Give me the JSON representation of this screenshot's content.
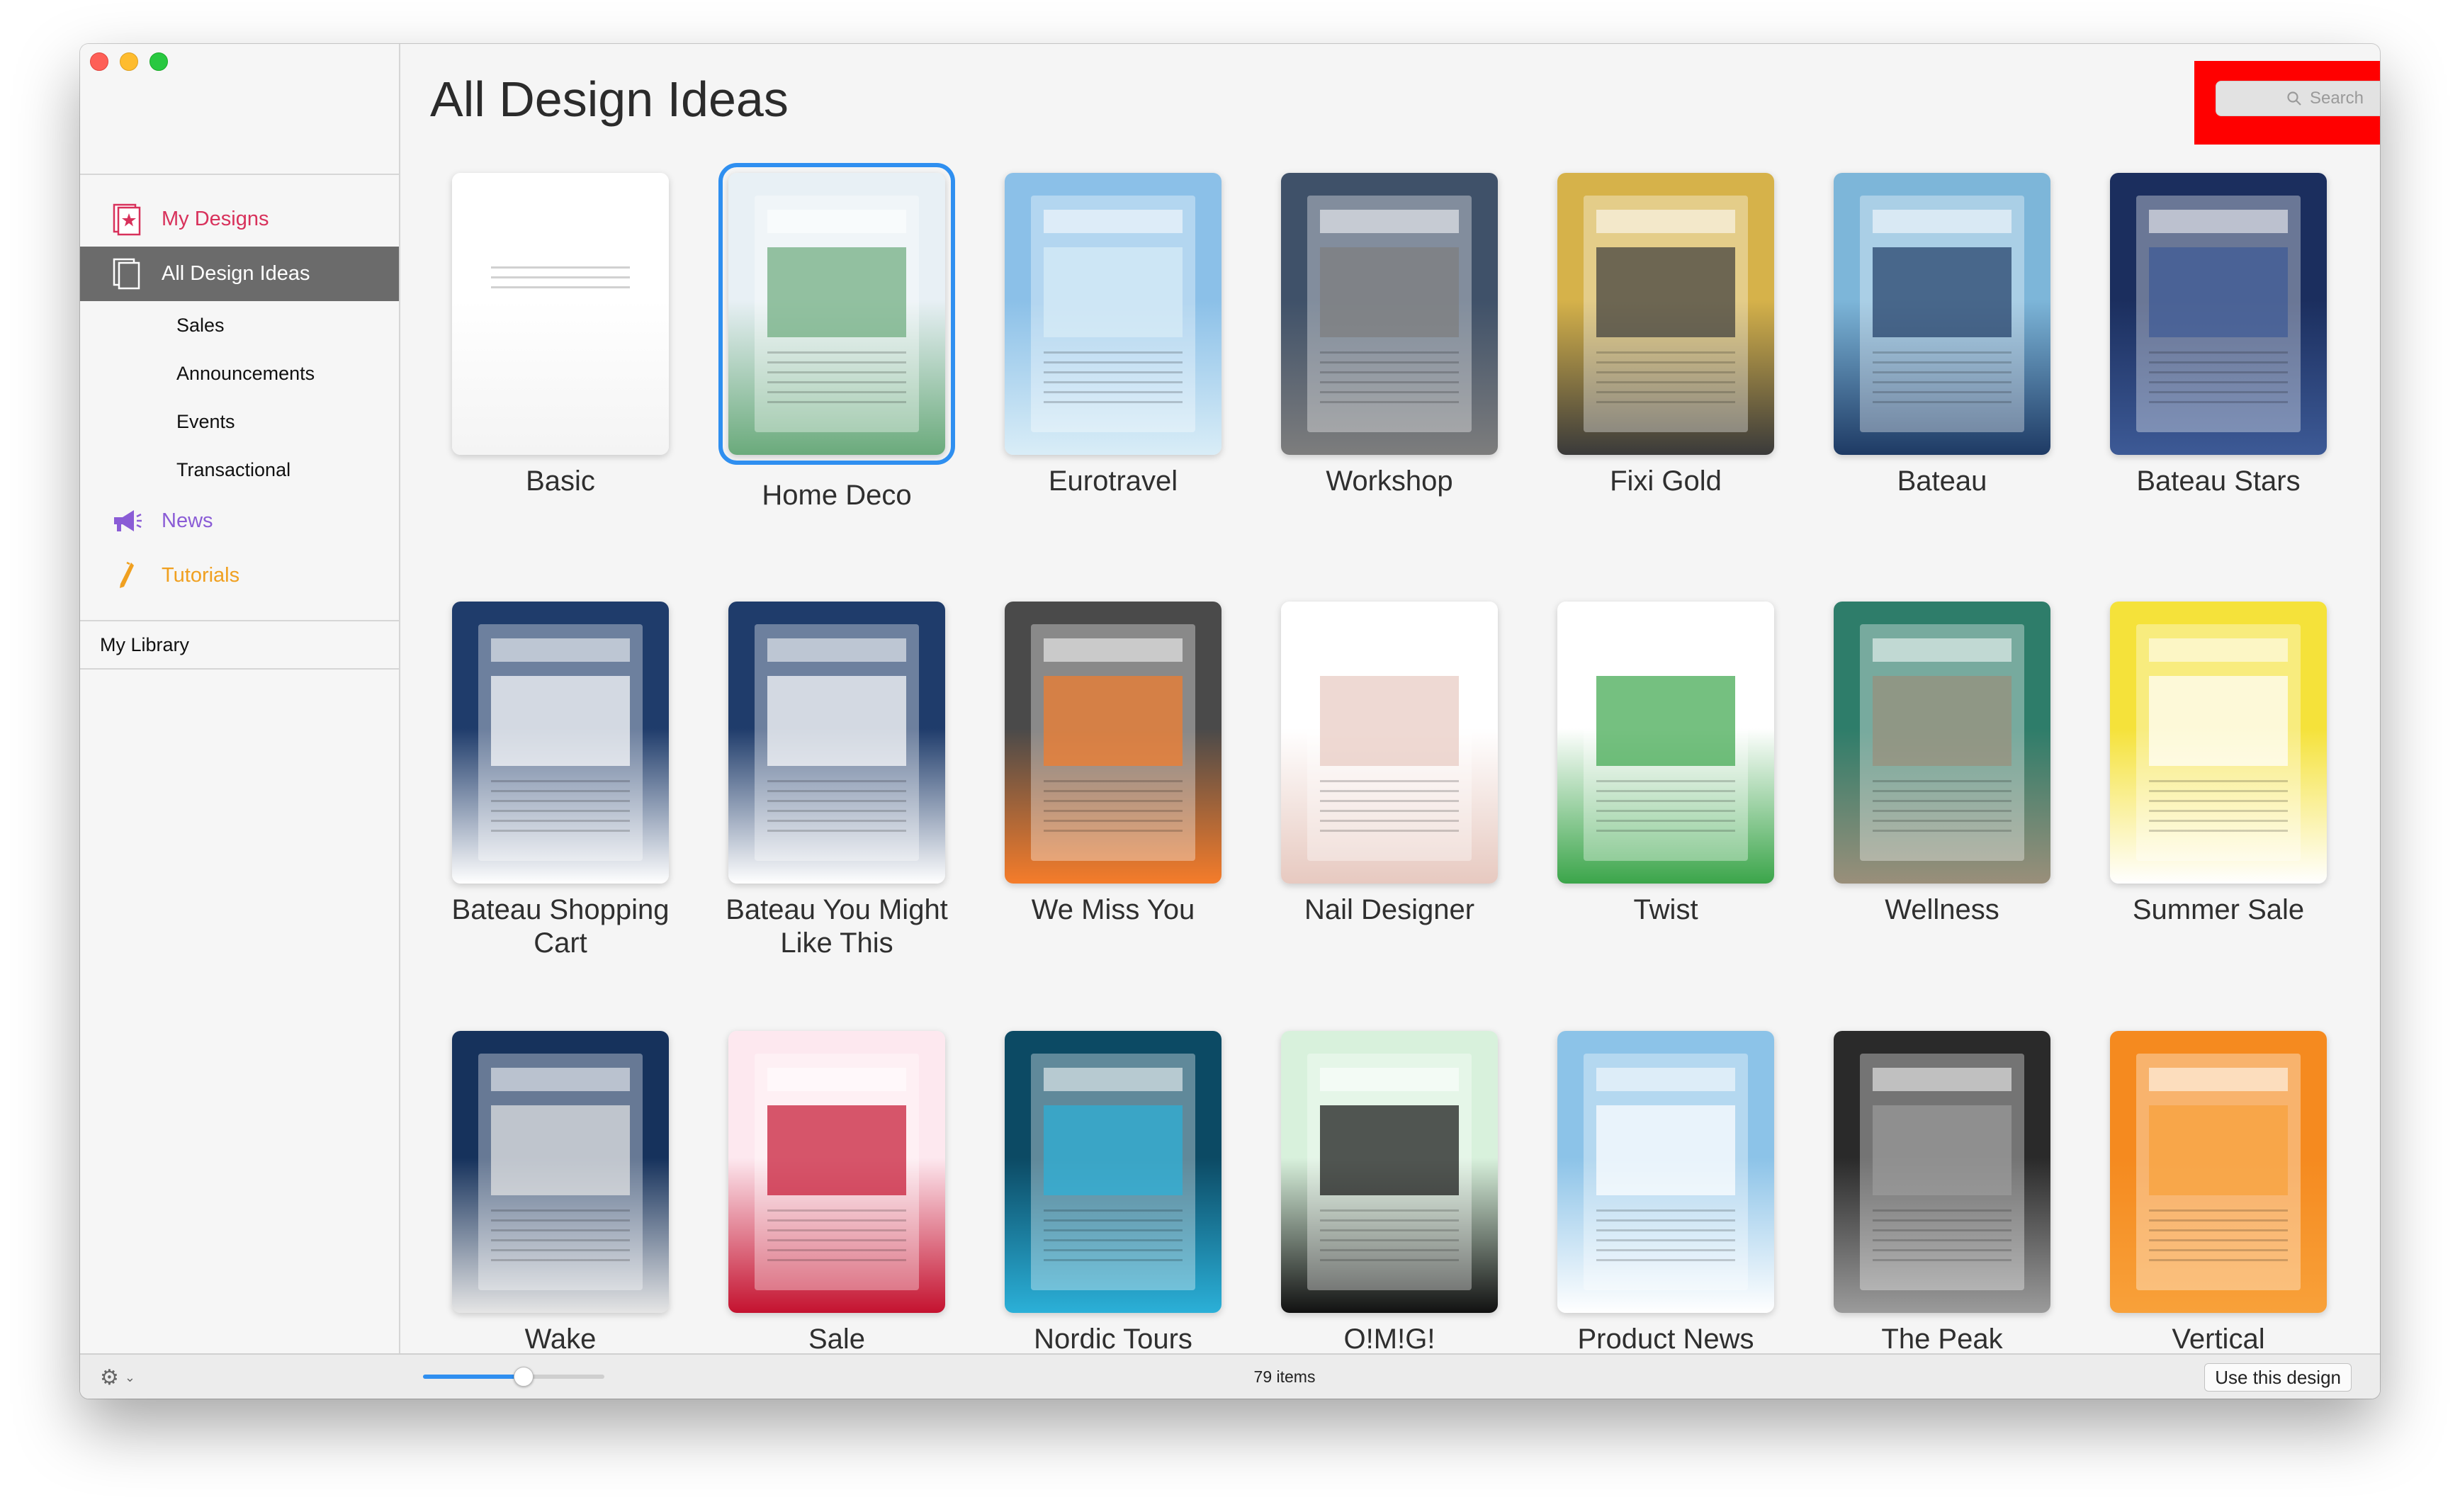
{
  "sidebar": {
    "items": [
      {
        "label": "My Designs",
        "icon": "my-designs-icon"
      },
      {
        "label": "All Design Ideas",
        "icon": "all-designs-icon"
      },
      {
        "label": "Sales"
      },
      {
        "label": "Announcements"
      },
      {
        "label": "Events"
      },
      {
        "label": "Transactional"
      },
      {
        "label": "News",
        "icon": "megaphone-icon"
      },
      {
        "label": "Tutorials",
        "icon": "pen-icon"
      }
    ],
    "library": "My Library"
  },
  "header": {
    "title": "All Design Ideas",
    "search_placeholder": "Search"
  },
  "designs": [
    {
      "name": "Basic",
      "colors": [
        "#ffffff",
        "#f4f4f4"
      ]
    },
    {
      "name": "Home Deco",
      "colors": [
        "#e8f0f5",
        "#6aaa7b"
      ]
    },
    {
      "name": "Eurotravel",
      "colors": [
        "#8bc0e8",
        "#d9edf7"
      ]
    },
    {
      "name": "Workshop",
      "colors": [
        "#3f5169",
        "#7d7d7d"
      ]
    },
    {
      "name": "Fixi Gold",
      "colors": [
        "#d6b24a",
        "#3a3a3a"
      ]
    },
    {
      "name": "Bateau",
      "colors": [
        "#7db6d9",
        "#1e3a64"
      ]
    },
    {
      "name": "Bateau Stars",
      "colors": [
        "#1b2e5e",
        "#3d5a96"
      ]
    },
    {
      "name": "Bateau Shopping Cart",
      "colors": [
        "#1f3c6b",
        "#ffffff"
      ]
    },
    {
      "name": "Bateau You Might Like This",
      "colors": [
        "#1f3c6b",
        "#ffffff"
      ]
    },
    {
      "name": "We Miss You",
      "colors": [
        "#4a4a4a",
        "#f57c2a"
      ]
    },
    {
      "name": "Nail Designer",
      "colors": [
        "#ffffff",
        "#e7c9c0"
      ]
    },
    {
      "name": "Twist",
      "colors": [
        "#ffffff",
        "#3ba54a"
      ]
    },
    {
      "name": "Wellness",
      "colors": [
        "#2e7d6a",
        "#9a8f7a"
      ]
    },
    {
      "name": "Summer Sale",
      "colors": [
        "#f5e23a",
        "#ffffff"
      ]
    },
    {
      "name": "Wake",
      "colors": [
        "#16325c",
        "#e5e5e5"
      ]
    },
    {
      "name": "Sale",
      "colors": [
        "#fde8ef",
        "#c4122f"
      ]
    },
    {
      "name": "Nordic Tours",
      "colors": [
        "#0c4a64",
        "#2bb0d8"
      ]
    },
    {
      "name": "O!M!G!",
      "colors": [
        "#d8f1dc",
        "#111111"
      ]
    },
    {
      "name": "Product News",
      "colors": [
        "#8cc3e8",
        "#ffffff"
      ]
    },
    {
      "name": "The Peak",
      "colors": [
        "#2a2a2a",
        "#9b9b9b"
      ]
    },
    {
      "name": "Vertical",
      "colors": [
        "#f58a1f",
        "#f8a13a"
      ]
    }
  ],
  "status": {
    "items_count": "79 items",
    "use_button": "Use this design",
    "zoom_level": 0.55
  },
  "colors": {
    "accent": "#2f8ff0",
    "highlight": "#ff0000"
  }
}
